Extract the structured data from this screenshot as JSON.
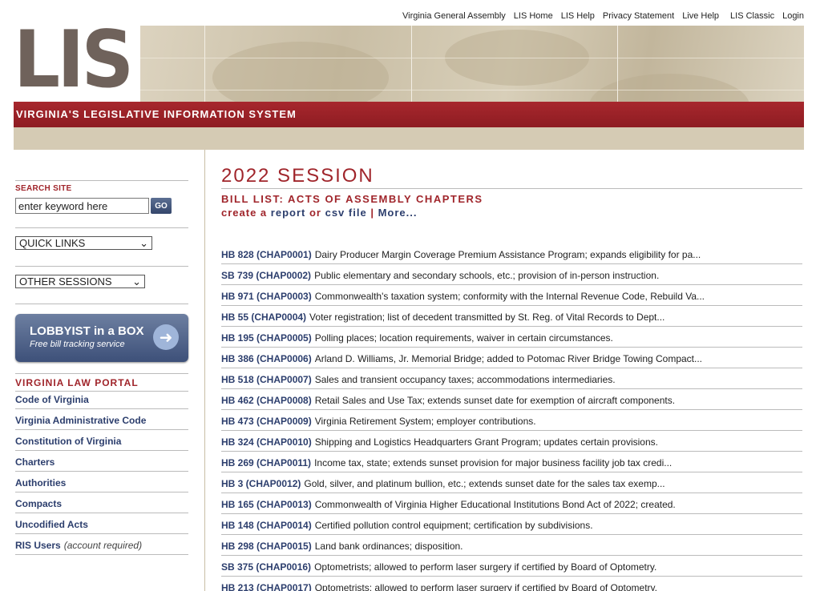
{
  "top_links": [
    "Virginia General Assembly",
    "LIS Home",
    "LIS Help",
    "Privacy Statement",
    "Live Help",
    "LIS Classic",
    "Login"
  ],
  "banner": {
    "logo": "LIS",
    "title": "VIRGINIA'S LEGISLATIVE INFORMATION SYSTEM"
  },
  "sidebar": {
    "search_label": "SEARCH SITE",
    "search_value": "enter keyword here",
    "go_label": "GO",
    "quick_links": "QUICK LINKS",
    "other_sessions": "OTHER SESSIONS",
    "lobbyist_title": "LOBBYIST in a BOX",
    "lobbyist_sub": "Free bill tracking service",
    "portal_title": "VIRGINIA LAW PORTAL",
    "portal_links": [
      "Code of Virginia",
      "Virginia Administrative Code",
      "Constitution of Virginia",
      "Charters",
      "Authorities",
      "Compacts",
      "Uncodified Acts",
      "RIS Users"
    ],
    "ris_note": "(account required)"
  },
  "main": {
    "session": "2022 SESSION",
    "bill_list_title": "BILL LIST: ACTS OF ASSEMBLY CHAPTERS",
    "create_a": "create a",
    "report": "report",
    "or": "or",
    "csv": "csv file",
    "sep": "|",
    "more": "More...",
    "bills": [
      {
        "id": "HB 828 (CHAP0001)",
        "desc": "Dairy Producer Margin Coverage Premium Assistance Program; expands eligibility for pa..."
      },
      {
        "id": "SB 739 (CHAP0002)",
        "desc": "Public elementary and secondary schools, etc.; provision of in-person instruction."
      },
      {
        "id": "HB 971 (CHAP0003)",
        "desc": "Commonwealth's taxation system; conformity with the Internal Revenue Code, Rebuild Va..."
      },
      {
        "id": "HB 55 (CHAP0004)",
        "desc": "Voter registration; list of decedent transmitted by St. Reg. of Vital Records to Dept..."
      },
      {
        "id": "HB 195 (CHAP0005)",
        "desc": "Polling places; location requirements, waiver in certain circumstances."
      },
      {
        "id": "HB 386 (CHAP0006)",
        "desc": "Arland D. Williams, Jr. Memorial Bridge; added to Potomac River Bridge Towing Compact..."
      },
      {
        "id": "HB 518 (CHAP0007)",
        "desc": "Sales and transient occupancy taxes; accommodations intermediaries."
      },
      {
        "id": "HB 462 (CHAP0008)",
        "desc": "Retail Sales and Use Tax; extends sunset date for exemption of aircraft components."
      },
      {
        "id": "HB 473 (CHAP0009)",
        "desc": "Virginia Retirement System; employer contributions."
      },
      {
        "id": "HB 324 (CHAP0010)",
        "desc": "Shipping and Logistics Headquarters Grant Program; updates certain provisions."
      },
      {
        "id": "HB 269 (CHAP0011)",
        "desc": "Income tax, state; extends sunset provision for major business facility job tax credi..."
      },
      {
        "id": "HB 3 (CHAP0012)",
        "desc": "Gold, silver, and platinum bullion, etc.; extends sunset date for the sales tax exemp..."
      },
      {
        "id": "HB 165 (CHAP0013)",
        "desc": "Commonwealth of Virginia Higher Educational Institutions Bond Act of 2022; created."
      },
      {
        "id": "HB 148 (CHAP0014)",
        "desc": "Certified pollution control equipment; certification by subdivisions."
      },
      {
        "id": "HB 298 (CHAP0015)",
        "desc": "Land bank ordinances; disposition."
      },
      {
        "id": "SB 375 (CHAP0016)",
        "desc": "Optometrists; allowed to perform laser surgery if certified by Board of Optometry."
      },
      {
        "id": "HB 213 (CHAP0017)",
        "desc": "Optometrists; allowed to perform laser surgery if certified by Board of Optometry."
      }
    ]
  }
}
